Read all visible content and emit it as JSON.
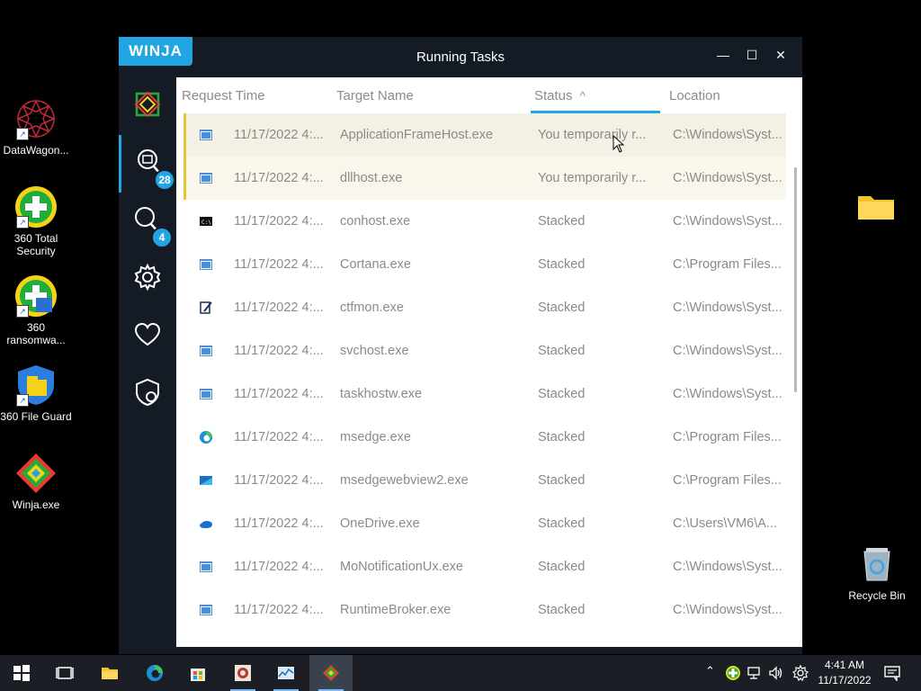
{
  "desktop": {
    "icons": [
      {
        "label": "DataWagon..."
      },
      {
        "label": "360 Total Security"
      },
      {
        "label": "360 ransomwa..."
      },
      {
        "label": "360 File Guard"
      },
      {
        "label": "Winja.exe"
      },
      {
        "label": "Recycle Bin"
      }
    ]
  },
  "window": {
    "brand": "WINJA",
    "title": "Running Tasks",
    "controls": {
      "minimize": "—",
      "maximize": "☐",
      "close": "✕"
    }
  },
  "sidebar": {
    "items": [
      {
        "name": "logo",
        "badge": ""
      },
      {
        "name": "running-tasks",
        "badge": "28"
      },
      {
        "name": "search-process",
        "badge": "4"
      },
      {
        "name": "settings",
        "badge": ""
      },
      {
        "name": "favorites",
        "badge": ""
      },
      {
        "name": "protection",
        "badge": ""
      }
    ]
  },
  "table": {
    "headers": {
      "request_time": "Request Time",
      "target_name": "Target Name",
      "status": "Status",
      "location": "Location"
    },
    "sort_indicator": "^",
    "rows": [
      {
        "time": "11/17/2022 4:...",
        "name": "ApplicationFrameHost.exe",
        "status": "You temporarily r...",
        "location": "C:\\Windows\\Syst...",
        "icon": "window-icon"
      },
      {
        "time": "11/17/2022 4:...",
        "name": "dllhost.exe",
        "status": "You temporarily r...",
        "location": "C:\\Windows\\Syst...",
        "icon": "window-icon"
      },
      {
        "time": "11/17/2022 4:...",
        "name": "conhost.exe",
        "status": "Stacked",
        "location": "C:\\Windows\\Syst...",
        "icon": "console-icon"
      },
      {
        "time": "11/17/2022 4:...",
        "name": "Cortana.exe",
        "status": "Stacked",
        "location": "C:\\Program Files...",
        "icon": "window-icon"
      },
      {
        "time": "11/17/2022 4:...",
        "name": "ctfmon.exe",
        "status": "Stacked",
        "location": "C:\\Windows\\Syst...",
        "icon": "pen-icon"
      },
      {
        "time": "11/17/2022 4:...",
        "name": "svchost.exe",
        "status": "Stacked",
        "location": "C:\\Windows\\Syst...",
        "icon": "window-icon"
      },
      {
        "time": "11/17/2022 4:...",
        "name": "taskhostw.exe",
        "status": "Stacked",
        "location": "C:\\Windows\\Syst...",
        "icon": "window-icon"
      },
      {
        "time": "11/17/2022 4:...",
        "name": "msedge.exe",
        "status": "Stacked",
        "location": "C:\\Program Files...",
        "icon": "edge-icon"
      },
      {
        "time": "11/17/2022 4:...",
        "name": "msedgewebview2.exe",
        "status": "Stacked",
        "location": "C:\\Program Files...",
        "icon": "webview-icon"
      },
      {
        "time": "11/17/2022 4:...",
        "name": "OneDrive.exe",
        "status": "Stacked",
        "location": "C:\\Users\\VM6\\A...",
        "icon": "cloud-icon"
      },
      {
        "time": "11/17/2022 4:...",
        "name": "MoNotificationUx.exe",
        "status": "Stacked",
        "location": "C:\\Windows\\Syst...",
        "icon": "window-icon"
      },
      {
        "time": "11/17/2022 4:...",
        "name": "RuntimeBroker.exe",
        "status": "Stacked",
        "location": "C:\\Windows\\Syst...",
        "icon": "window-icon"
      }
    ]
  },
  "taskbar": {
    "items": [
      "windows-start-icon",
      "task-view-icon",
      "file-explorer-icon",
      "edge-icon",
      "store-icon",
      "app-icon",
      "monitor-icon",
      "winja-icon"
    ],
    "clock": {
      "time": "4:41 AM",
      "date": "11/17/2022"
    }
  },
  "colors": {
    "accent": "#22a6e3",
    "highlight_bar": "#e3c43b",
    "window_bg": "#141b24"
  }
}
